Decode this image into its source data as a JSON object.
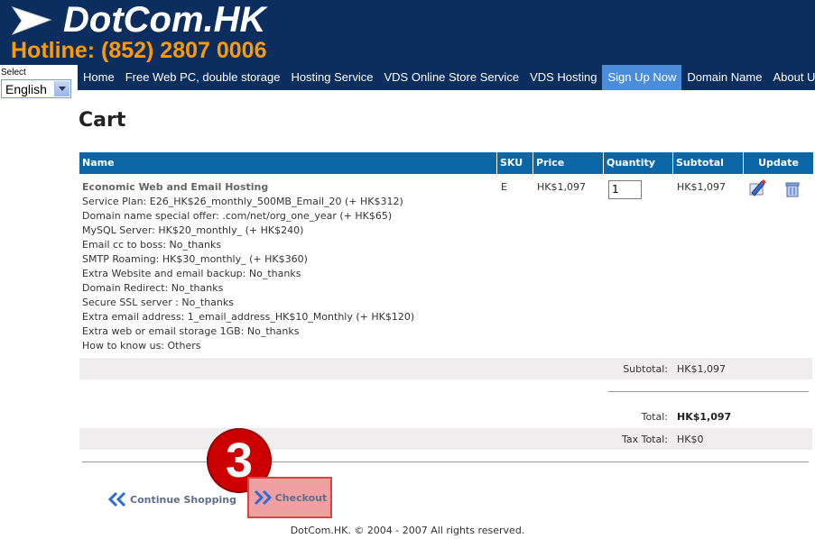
{
  "header": {
    "logo_text": "DotCom.HK",
    "hotline": "Hotline: (852) 2807 0006"
  },
  "language": {
    "label": "Select",
    "selected": "English"
  },
  "nav": {
    "items": [
      {
        "label": "Home"
      },
      {
        "label": "Free Web PC, double storage"
      },
      {
        "label": "Hosting Service"
      },
      {
        "label": "VDS Online Store Service"
      },
      {
        "label": "VDS Hosting"
      },
      {
        "label": "Sign Up Now",
        "active": true
      },
      {
        "label": "Domain Name"
      },
      {
        "label": "About Us"
      }
    ]
  },
  "page_title": "Cart",
  "table": {
    "headers": {
      "name": "Name",
      "sku": "SKU",
      "price": "Price",
      "quantity": "Quantity",
      "subtotal": "Subtotal",
      "update": "Update"
    },
    "row": {
      "product": "Economic Web and Email Hosting",
      "options": [
        "Service Plan: E26_HK$26_monthly_500MB_Email_20 (+ HK$312)",
        "Domain name special offer: .com/net/org_one_year (+ HK$65)",
        "MySQL Server: HK$20_monthly_ (+ HK$240)",
        "Email cc to boss: No_thanks",
        "SMTP Roaming: HK$30_monthly_ (+ HK$360)",
        "Extra Website and email backup: No_thanks",
        "Domain Redirect: No_thanks",
        "Secure SSL server : No_thanks",
        "Extra email address: 1_email_address_HK$10_Monthly (+ HK$120)",
        "Extra web or email storage 1GB: No_thanks",
        "How to know us: Others"
      ],
      "sku": "E",
      "price": "HK$1,097",
      "quantity": "1",
      "subtotal": "HK$1,097"
    },
    "totals": {
      "subtotal_label": "Subtotal:",
      "subtotal_value": "HK$1,097",
      "total_label": "Total:",
      "total_value": "HK$1,097",
      "tax_label": "Tax Total:",
      "tax_value": "HK$0"
    }
  },
  "actions": {
    "continue": "Continue Shopping",
    "checkout": "Checkout",
    "step_number": "3"
  },
  "footer": "DotCom.HK. © 2004 - 2007 All rights reserved."
}
